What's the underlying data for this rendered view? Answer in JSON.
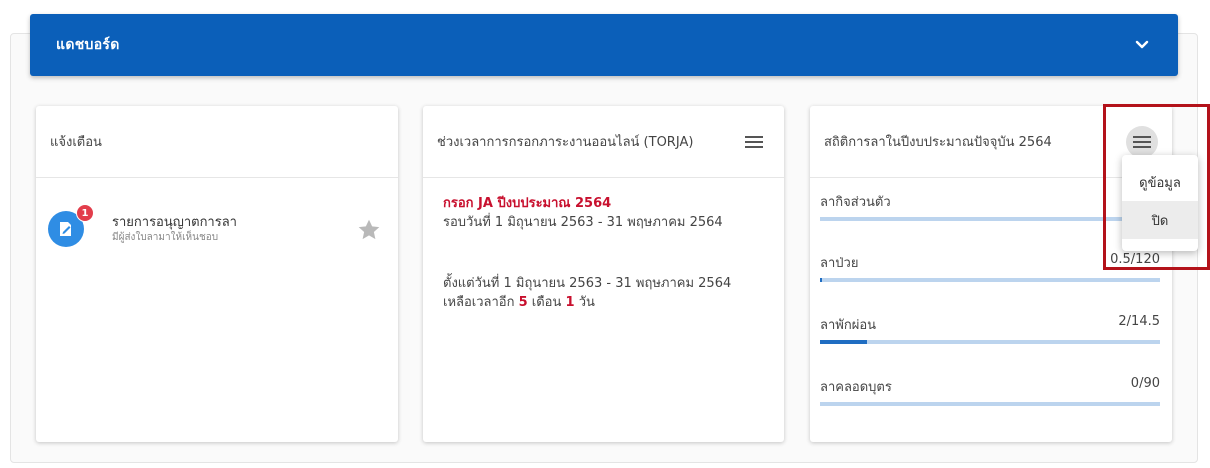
{
  "header": {
    "title": "แดชบอร์ด"
  },
  "cards": {
    "notifications": {
      "title": "แจ้งเตือน",
      "item": {
        "badge": "1",
        "title": "รายการอนุญาตการลา",
        "subtitle": "มีผู้ส่งใบลามาให้เห็นชอบ"
      }
    },
    "torja": {
      "title": "ช่วงเวลาการกรอกภาระงานออนไลน์ (TORJA)",
      "heading": "กรอก JA ปีงบประมาณ 2564",
      "round": "รอบวันที่ 1 มิถุนายน 2563 - 31 พฤษภาคม 2564",
      "since": "ตั้งแต่วันที่ 1 มิถุนายน 2563 - 31 พฤษภาคม 2564",
      "remaining_prefix": "เหลือเวลาอีก ",
      "months": "5",
      "months_unit": " เดือน ",
      "days": "1",
      "days_unit": " วัน"
    },
    "leave_stats": {
      "title": "สถิติการลาในปีงบประมาณปัจจุบัน 2564",
      "rows": [
        {
          "label": "ลากิจส่วนตัว",
          "value": "",
          "fraction": 0.0
        },
        {
          "label": "ลาป่วย",
          "value": "0.5/120",
          "fraction": 0.004
        },
        {
          "label": "ลาพักผ่อน",
          "value": "2/14.5",
          "fraction": 0.138
        },
        {
          "label": "ลาคลอดบุตร",
          "value": "0/90",
          "fraction": 0.0
        }
      ]
    }
  },
  "dropdown": {
    "items": [
      "ดูข้อมูล",
      "ปิด"
    ]
  },
  "colors": {
    "header": "#0b5fb9",
    "accent_red": "#c8102e",
    "badge": "#e23d4b",
    "progress_fill": "#1f6dc2",
    "progress_track": "#bcd4ee",
    "highlight": "#b3121a"
  }
}
